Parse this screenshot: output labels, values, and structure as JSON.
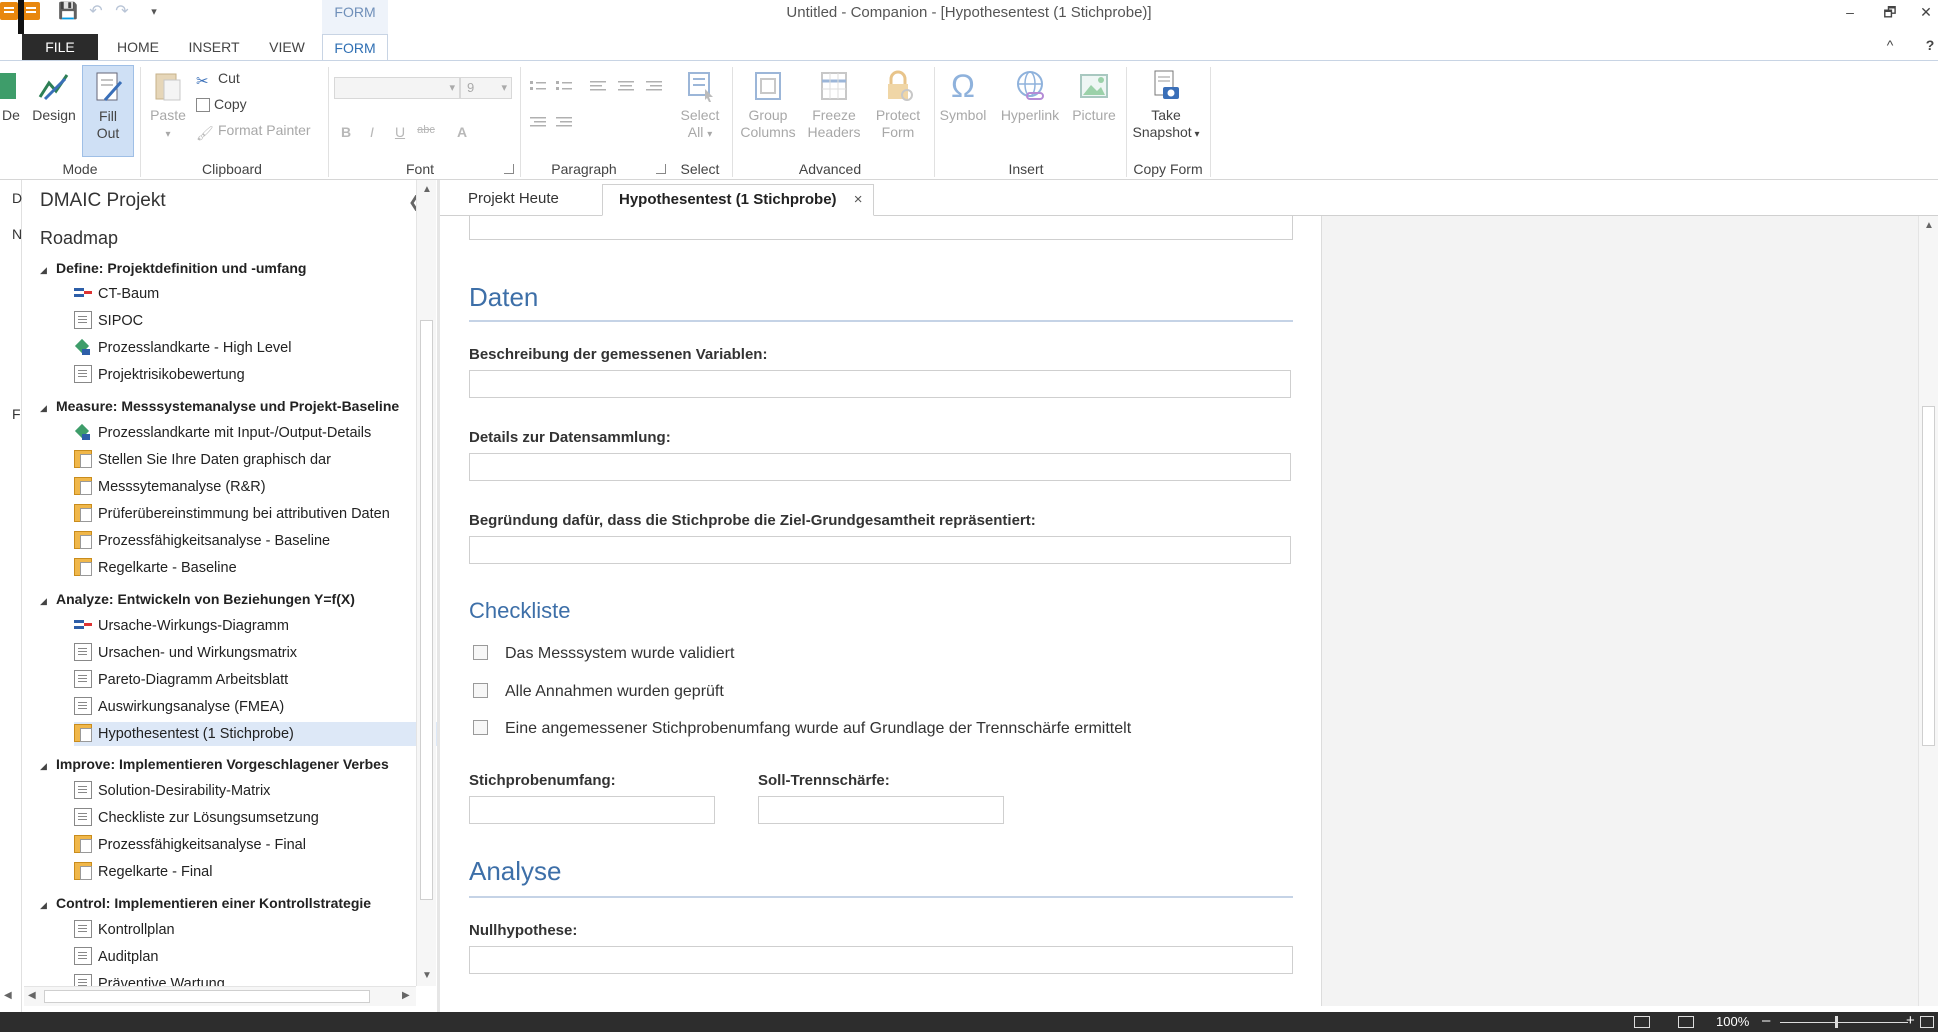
{
  "titlebar": {
    "app_title": "Untitled - Companion - [Hypothesentest (1 Stichprobe)]",
    "context_tab": "FORM",
    "minimize": "–",
    "restore": "🗗",
    "close": "✕"
  },
  "ribbon_tabs": {
    "file": "FILE",
    "home": "HOME",
    "insert": "INSERT",
    "view": "VIEW",
    "form": "FORM",
    "collapse": "^",
    "help": "?"
  },
  "ribbon": {
    "mode": {
      "label": "Mode",
      "design": "Design",
      "fill_out_line1": "Fill",
      "fill_out_line2": "Out",
      "cut_off": "De"
    },
    "clipboard": {
      "label": "Clipboard",
      "paste": "Paste",
      "cut": "Cut",
      "copy": "Copy",
      "format_painter": "Format Painter"
    },
    "font": {
      "label": "Font",
      "size": "9",
      "bold": "B",
      "italic": "I",
      "underline": "U",
      "strike": "abc",
      "color": "A"
    },
    "paragraph": {
      "label": "Paragraph"
    },
    "select": {
      "label": "Select",
      "select_all_line1": "Select",
      "select_all_line2": "All"
    },
    "advanced": {
      "label": "Advanced",
      "group_line1": "Group",
      "group_line2": "Columns",
      "freeze_line1": "Freeze",
      "freeze_line2": "Headers",
      "protect_line1": "Protect",
      "protect_line2": "Form"
    },
    "insert": {
      "label": "Insert",
      "symbol": "Symbol",
      "hyperlink": "Hyperlink",
      "picture": "Picture"
    },
    "copy_form": {
      "label": "Copy Form",
      "take_line1": "Take",
      "take_line2": "Snapshot"
    }
  },
  "navigator": {
    "title": "DMAIC Projekt",
    "roadmap": "Roadmap",
    "phases": [
      {
        "name": "Define:  Projektdefinition und -umfang",
        "items": [
          {
            "label": "CT-Baum",
            "icon": "tree"
          },
          {
            "label": "SIPOC",
            "icon": "doc"
          },
          {
            "label": "Prozesslandkarte - High Level",
            "icon": "map"
          },
          {
            "label": "Projektrisikobewertung",
            "icon": "doc"
          }
        ]
      },
      {
        "name": "Measure:  Messsystemanalyse und Projekt-Baseline",
        "items": [
          {
            "label": "Prozesslandkarte mit Input-/Output-Details",
            "icon": "map"
          },
          {
            "label": "Stellen Sie Ihre Daten graphisch dar",
            "icon": "folder"
          },
          {
            "label": "Messsytemanalyse (R&R)",
            "icon": "folder"
          },
          {
            "label": "Prüferübereinstimmung bei attributiven Daten",
            "icon": "folder"
          },
          {
            "label": "Prozessfähigkeitsanalyse - Baseline",
            "icon": "folder"
          },
          {
            "label": "Regelkarte - Baseline",
            "icon": "folder"
          }
        ]
      },
      {
        "name": "Analyze:  Entwickeln von Beziehungen Y=f(X)",
        "items": [
          {
            "label": "Ursache-Wirkungs-Diagramm",
            "icon": "tree"
          },
          {
            "label": "Ursachen- und Wirkungsmatrix",
            "icon": "doc"
          },
          {
            "label": "Pareto-Diagramm Arbeitsblatt",
            "icon": "doc"
          },
          {
            "label": "Auswirkungsanalyse (FMEA)",
            "icon": "doc"
          },
          {
            "label": "Hypothesentest (1 Stichprobe)",
            "icon": "folder"
          }
        ]
      },
      {
        "name": "Improve:  Implementieren Vorgeschlagener Verbes",
        "items": [
          {
            "label": "Solution-Desirability-Matrix",
            "icon": "doc"
          },
          {
            "label": "Checkliste zur Lösungsumsetzung",
            "icon": "doc"
          },
          {
            "label": "Prozessfähigkeitsanalyse - Final",
            "icon": "folder"
          },
          {
            "label": "Regelkarte - Final",
            "icon": "folder"
          }
        ]
      },
      {
        "name": "Control:  Implementieren einer Kontrollstrategie",
        "items": [
          {
            "label": "Kontrollplan",
            "icon": "doc"
          },
          {
            "label": "Auditplan",
            "icon": "doc"
          },
          {
            "label": "Präventive Wartung",
            "icon": "doc"
          }
        ]
      }
    ],
    "selected_item": "Hypothesentest (1 Stichprobe)"
  },
  "doc_tabs": {
    "tab1": "Projekt Heute",
    "tab2": "Hypothesentest (1 Stichprobe)",
    "close": "×"
  },
  "form": {
    "daten_title": "Daten",
    "beschreibung_label": "Beschreibung der gemessenen Variablen:",
    "details_label": "Details zur Datensammlung:",
    "begruendung_label": "Begründung dafür, dass die Stichprobe die Ziel-Grundgesamtheit repräsentiert:",
    "checkliste_title": "Checkliste",
    "checks": [
      {
        "label": "Das Messsystem wurde validiert",
        "checked": false
      },
      {
        "label": "Alle Annahmen wurden geprüft",
        "checked": false
      },
      {
        "label": "Eine angemessener Stichprobenumfang wurde auf Grundlage der Trennschärfe ermittelt",
        "checked": false
      }
    ],
    "stichprobe_label": "Stichprobenumfang:",
    "soll_label": "Soll-Trennschärfe:",
    "analyse_title": "Analyse",
    "nullhypothese_label": "Nullhypothese:"
  },
  "statusbar": {
    "zoom": "100%",
    "zoom_out": "–",
    "zoom_in": "+"
  }
}
